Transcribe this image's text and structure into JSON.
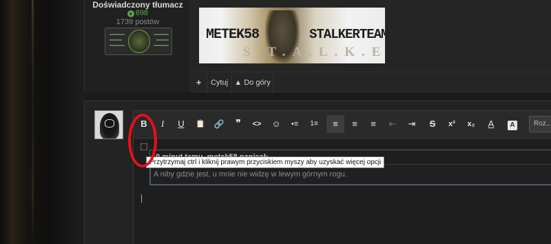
{
  "user": {
    "rank": "Doświadczony tłumacz",
    "reputation": "698",
    "posts": "1739 postów"
  },
  "signature": {
    "left_text": "METEK58",
    "right_text": "STALKERTEAM.PL",
    "bottom_text": "S.T.A.L.K.E.R"
  },
  "post_actions": {
    "add_label": "+",
    "quote_label": "Cytuj",
    "top_label": "▲ Do góry"
  },
  "toolbar": {
    "buttons": [
      "B",
      "I",
      "U",
      "📋",
      "🔗",
      "❞",
      "<>",
      "☺",
      "•≡",
      "1≡",
      "≡",
      "≡",
      "≡",
      "⇤",
      "⇥",
      "S",
      "x²",
      "x₂",
      "A",
      "A"
    ],
    "select_value": "Roz..."
  },
  "quote": {
    "header": "10 minut temu, metek58 napisał:",
    "body": "A niby gdzie jest, u mnie nie widzę w lewym górnym rogu."
  },
  "tooltip": {
    "text": "Przytrzymaj ctrl i kliknij prawym przyciskiem myszy aby uzyskać więcej opcji"
  },
  "colors": {
    "reputation": "#5fa54f",
    "annotation_circle": "#e8101a",
    "panel": "#252525"
  }
}
